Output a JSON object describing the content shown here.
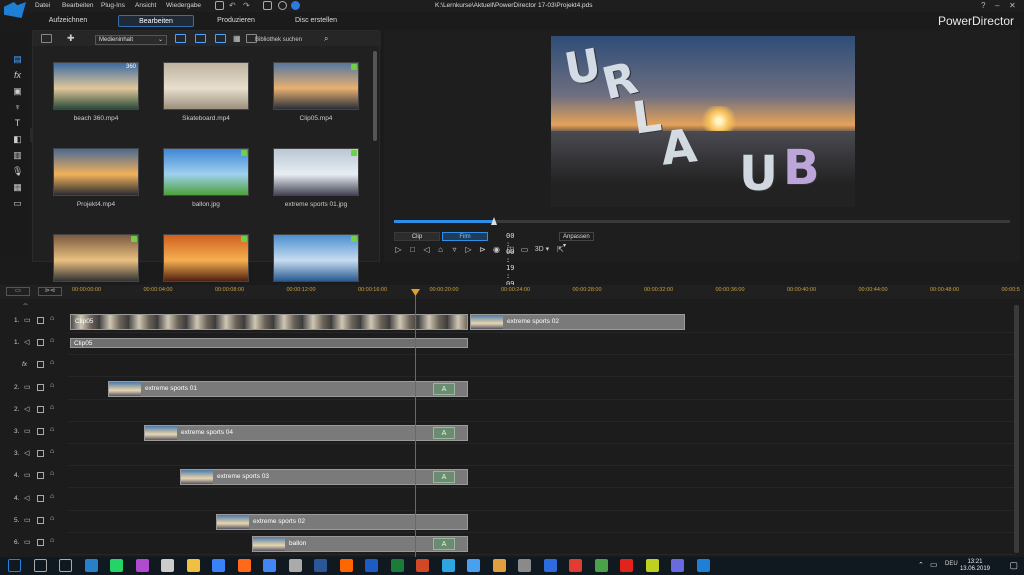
{
  "window": {
    "title": "K:\\Lernkurse\\Aktuell\\PowerDirector 17-03\\Projekt4.pds",
    "brand": "PowerDirector"
  },
  "menu": [
    "Datei",
    "Bearbeiten",
    "Plug-Ins",
    "Ansicht",
    "Wiedergabe"
  ],
  "tabs": [
    {
      "label": "Aufzeichnen"
    },
    {
      "label": "Bearbeiten",
      "active": true
    },
    {
      "label": "Produzieren"
    },
    {
      "label": "Disc erstellen"
    }
  ],
  "library": {
    "content_select": "Medieninhalt",
    "search_placeholder": "Bibliothek suchen",
    "items": [
      {
        "label": "beach 360.mp4",
        "badge": "360",
        "colors": [
          "#3b6aa0",
          "#e2c79a",
          "#2a4a3a"
        ]
      },
      {
        "label": "Skateboard.mp4",
        "colors": [
          "#bfb3a0",
          "#e8dfcf",
          "#9c8f7c"
        ]
      },
      {
        "label": "Clip05.mp4",
        "checked": true,
        "colors": [
          "#5577a0",
          "#e8b070",
          "#2a2f38"
        ]
      },
      {
        "label": "Projekt4.mp4",
        "colors": [
          "#4a6a94",
          "#f1b15a",
          "#2b2b30"
        ]
      },
      {
        "label": "ballon.jpg",
        "checked": true,
        "colors": [
          "#3f86d6",
          "#9fd0ee",
          "#4ca03a"
        ]
      },
      {
        "label": "extreme sports 01.jpg",
        "checked": true,
        "colors": [
          "#b9c6d4",
          "#e8eef3",
          "#445"
        ]
      },
      {
        "label": "",
        "checked": true,
        "colors": [
          "#7a5a40",
          "#e9c080",
          "#333"
        ]
      },
      {
        "label": "",
        "checked": true,
        "colors": [
          "#d06020",
          "#f5b050",
          "#502010"
        ]
      },
      {
        "label": "",
        "checked": true,
        "colors": [
          "#4a90d0",
          "#c7dcf0",
          "#2a5a90"
        ]
      }
    ]
  },
  "preview": {
    "title_letters": [
      "U",
      "R",
      "L",
      "A",
      "U",
      "B"
    ],
    "mode_clip": "Clip",
    "mode_film": "Film",
    "timecode": "00 : 00 : 19 : 09",
    "fit": "Anpassen",
    "res3d": "3D"
  },
  "ruler": [
    "00:00:00:00",
    "00:00:04:00",
    "00:00:08:00",
    "00:00:12:00",
    "00:00:16:00",
    "00:00:20:00",
    "00:00:24:00",
    "00:00:28:00",
    "00:00:32:00",
    "00:00:36:00",
    "00:00:40:00",
    "00:00:44:00",
    "00:00:48:00",
    "00:00:5"
  ],
  "tracks": [
    {
      "label": "1.",
      "kind": "video",
      "clips": [
        {
          "name": "Clip05",
          "type": "vid",
          "start": 0,
          "end": 398
        },
        {
          "name": "extreme sports 02",
          "type": "img",
          "start": 400,
          "end": 615
        }
      ]
    },
    {
      "label": "1.",
      "kind": "audio",
      "clips": [
        {
          "name": "Clip05",
          "type": "aud",
          "start": 0,
          "end": 398
        }
      ]
    },
    {
      "label": "fx",
      "kind": "fx",
      "clips": []
    },
    {
      "label": "2.",
      "kind": "video",
      "clips": [
        {
          "name": "extreme sports 01",
          "type": "img",
          "start": 38,
          "end": 398,
          "title": "A"
        }
      ]
    },
    {
      "label": "2.",
      "kind": "audio",
      "clips": []
    },
    {
      "label": "3.",
      "kind": "video",
      "clips": [
        {
          "name": "extreme sports 04",
          "type": "img",
          "start": 74,
          "end": 398,
          "title": "A"
        }
      ]
    },
    {
      "label": "3.",
      "kind": "audio",
      "clips": []
    },
    {
      "label": "4.",
      "kind": "video",
      "clips": [
        {
          "name": "extreme sports 03",
          "type": "img",
          "start": 110,
          "end": 398,
          "title": "A"
        }
      ]
    },
    {
      "label": "4.",
      "kind": "audio",
      "clips": []
    },
    {
      "label": "5.",
      "kind": "video",
      "clips": [
        {
          "name": "extreme sports 02",
          "type": "img",
          "start": 146,
          "end": 398
        }
      ]
    },
    {
      "label": "6.",
      "kind": "video",
      "clips": [
        {
          "name": "ballon",
          "type": "img",
          "start": 182,
          "end": 398,
          "title": "A"
        }
      ]
    }
  ],
  "taskbar": {
    "lang": "DEU",
    "time": "13:21",
    "date": "13.06.2019"
  }
}
